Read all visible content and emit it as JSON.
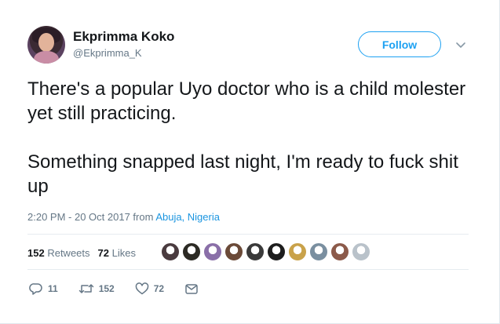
{
  "user": {
    "display_name": "Ekprimma Koko",
    "handle": "@Ekprimma_K"
  },
  "follow_label": "Follow",
  "tweet": {
    "paragraphs": [
      "There's a popular Uyo doctor who is a child molester yet still practicing.",
      "Something snapped last night, I'm ready to fuck shit up"
    ],
    "timestamp": "2:20 PM - 20 Oct 2017 from ",
    "location": "Abuja, Nigeria"
  },
  "stats": {
    "retweets_count": "152",
    "retweets_label": "Retweets",
    "likes_count": "72",
    "likes_label": "Likes"
  },
  "liker_avatars": [
    "#4a3b3f",
    "#2c2a24",
    "#8a6fa8",
    "#6b4a38",
    "#3a3a3a",
    "#1d1d1d",
    "#c9a24a",
    "#7a8fa0",
    "#8c5a4a",
    "#b9c2ca"
  ],
  "actions": {
    "replies": "11",
    "retweets": "152",
    "likes": "72"
  },
  "colors": {
    "accent": "#1da1f2",
    "text": "#14171a",
    "muted": "#657786"
  }
}
